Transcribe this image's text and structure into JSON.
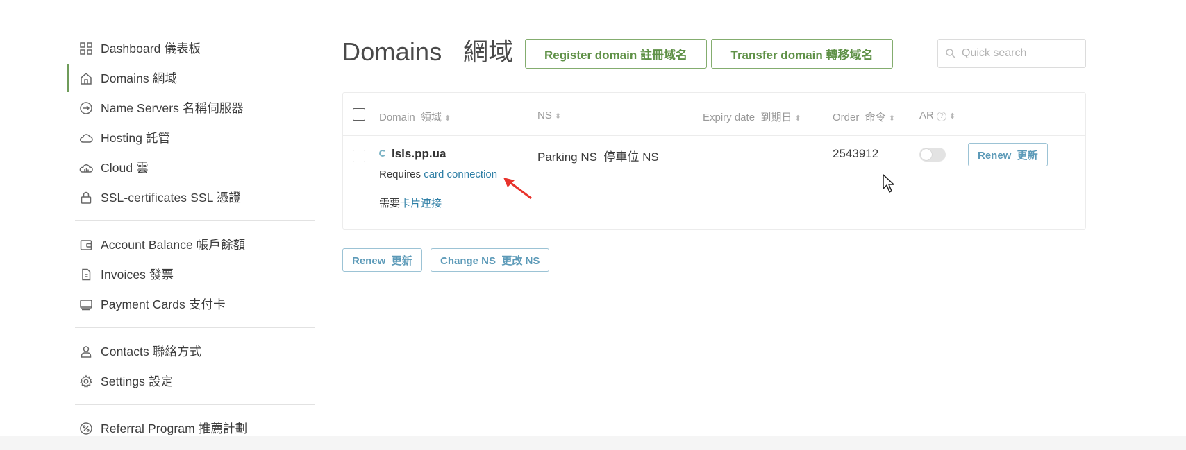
{
  "sidebar": {
    "group1": [
      {
        "label": "Dashboard  儀表板",
        "icon": "grid-icon"
      },
      {
        "label": "Domains  網域",
        "icon": "home-icon",
        "active": true
      },
      {
        "label": "Name Servers  名稱伺服器",
        "icon": "arrow-circle-icon"
      },
      {
        "label": "Hosting  託管",
        "icon": "cloud-icon"
      },
      {
        "label": "Cloud  雲",
        "icon": "cloud-chart-icon"
      },
      {
        "label": "SSL-certificates  SSL 憑證",
        "icon": "lock-icon"
      }
    ],
    "group2": [
      {
        "label": "Account Balance  帳戶餘額",
        "icon": "wallet-icon"
      },
      {
        "label": "Invoices  發票",
        "icon": "document-icon"
      },
      {
        "label": "Payment Cards  支付卡",
        "icon": "card-icon"
      }
    ],
    "group3": [
      {
        "label": "Contacts  聯絡方式",
        "icon": "user-icon"
      },
      {
        "label": "Settings  設定",
        "icon": "gear-icon"
      }
    ],
    "group4": [
      {
        "label": "Referral Program  推薦計劃",
        "icon": "percent-icon"
      }
    ]
  },
  "header": {
    "title": "Domains   網域",
    "register_label": "Register domain  註冊域名",
    "transfer_label": "Transfer domain  轉移域名",
    "search_placeholder": "Quick search"
  },
  "table": {
    "columns": {
      "domain": "Domain  領域",
      "ns": "NS",
      "expiry": "Expiry date  到期日",
      "order": "Order  命令",
      "ar": "AR"
    },
    "rows": [
      {
        "domain": "lsls.pp.ua",
        "requires_prefix": "Requires ",
        "requires_link": "card connection",
        "requires_zh_prefix": "需要",
        "requires_zh_link": "卡片連接",
        "ns": "Parking NS  停車位 NS",
        "expiry": "",
        "order": "2543912",
        "ar_enabled": false,
        "renew_label": "Renew  更新"
      }
    ]
  },
  "bulk_actions": {
    "renew_label": "Renew  更新",
    "change_ns_label": "Change NS  更改 NS"
  },
  "colors": {
    "accent_green": "#6f9c5a",
    "link_blue": "#2f7fa6",
    "annotation_red": "#e8322b"
  }
}
